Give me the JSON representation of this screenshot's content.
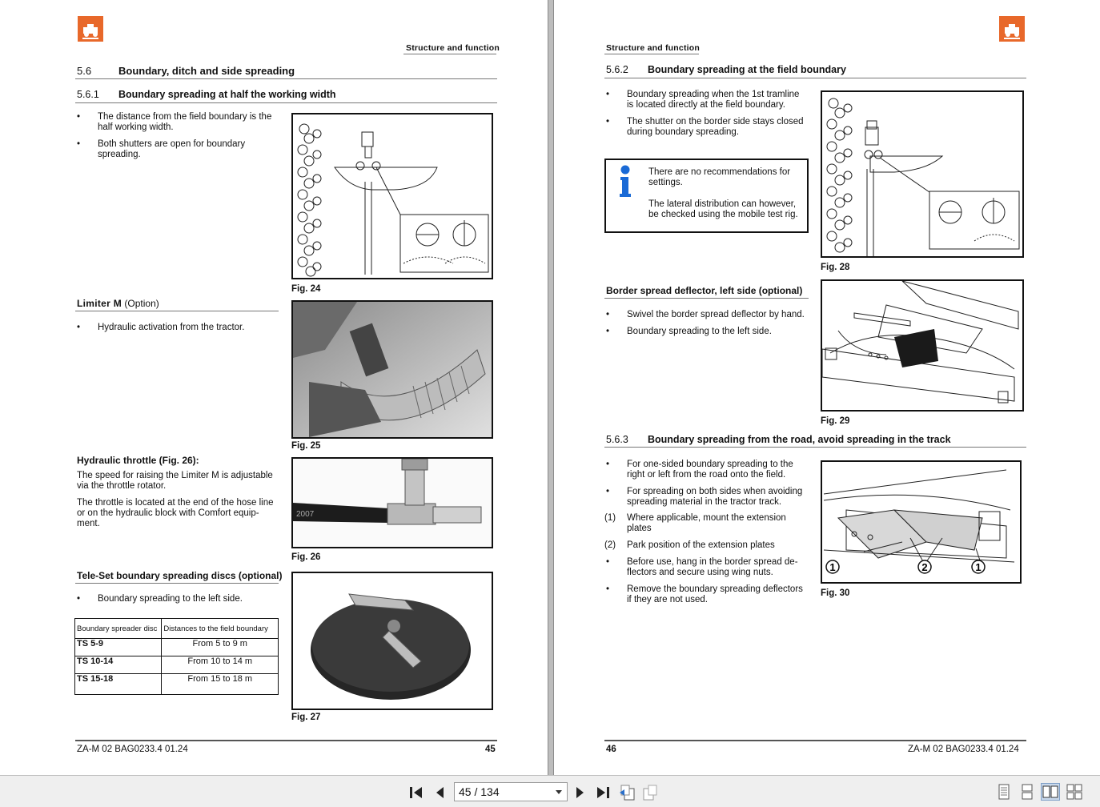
{
  "left_page": {
    "header": "Structure and function",
    "section": {
      "number": "5.6",
      "title": "Boundary, ditch and side spreading"
    },
    "subsection": {
      "number": "5.6.1",
      "title": "Boundary spreading at half the working width"
    },
    "bullets": [
      "The distance from the field boundary is the half working width.",
      "Both shutters are open for boundary spreading."
    ],
    "limiter": {
      "name": "Limiter M",
      "suffix": "(Option)",
      "bullet": "Hydraulic activation from the tractor."
    },
    "throttle": {
      "title": "Hydraulic throttle (Fig. 26):",
      "p1": "The speed for raising the Limiter M is adjustable via the throttle rotator.",
      "p2": "The throttle is located at the end of the hose line or on the hydraulic block with Comfort equip-ment."
    },
    "teleset": {
      "title": "Tele-Set boundary spreading discs (optional)",
      "bullet": "Boundary spreading to the left side."
    },
    "table": {
      "headers": [
        "Boundary spreader disc",
        "Distances to the field boundary"
      ],
      "rows": [
        [
          "TS 5-9",
          "From 5 to 9 m"
        ],
        [
          "TS 10-14",
          "From 10 to 14 m"
        ],
        [
          "TS 15-18",
          "From 15 to 18 m"
        ]
      ]
    },
    "figures": [
      "Fig. 24",
      "Fig. 25",
      "Fig. 26",
      "Fig. 27"
    ],
    "hose_text": "2007",
    "footer_left": "ZA-M 02  BAG0233.4  01.24",
    "footer_right": "45"
  },
  "right_page": {
    "header": "Structure and function",
    "subsection1": {
      "number": "5.6.2",
      "title": "Boundary spreading at the field boundary"
    },
    "bullets1": [
      "Boundary spreading when the 1st tramline is located directly at the field boundary.",
      "The shutter on the border side stays closed during boundary spreading."
    ],
    "info": {
      "p1": "There are no recommendations for settings.",
      "p2": "The lateral distribution can however, be checked using the mobile test rig."
    },
    "deflector": {
      "title": "Border spread deflector, left side (optional)",
      "bullets": [
        "Swivel the border spread deflector by hand.",
        "Boundary spreading to the left side."
      ]
    },
    "subsection2": {
      "number": "5.6.3",
      "title": "Boundary spreading from the road, avoid spreading in the track"
    },
    "list2": [
      {
        "mark": "•",
        "text": "For one-sided boundary spreading to the right or left from the road onto the field."
      },
      {
        "mark": "•",
        "text": "For spreading on both sides when avoiding spreading material in the tractor track."
      },
      {
        "mark": "(1)",
        "text": "Where applicable, mount the extension plates"
      },
      {
        "mark": "(2)",
        "text": "Park position of the extension plates"
      },
      {
        "mark": "•",
        "text": "Before use, hang in the border spread de-flectors and secure using wing nuts."
      },
      {
        "mark": "•",
        "text": "Remove the boundary spreading deflectors if they are not used."
      }
    ],
    "figures": [
      "Fig. 28",
      "Fig. 29",
      "Fig. 30"
    ],
    "callouts": [
      "1",
      "2",
      "1"
    ],
    "footer_left": "46",
    "footer_right": "ZA-M 02  BAG0233.4  01.24"
  },
  "toolbar": {
    "page_display": "45 / 134"
  }
}
